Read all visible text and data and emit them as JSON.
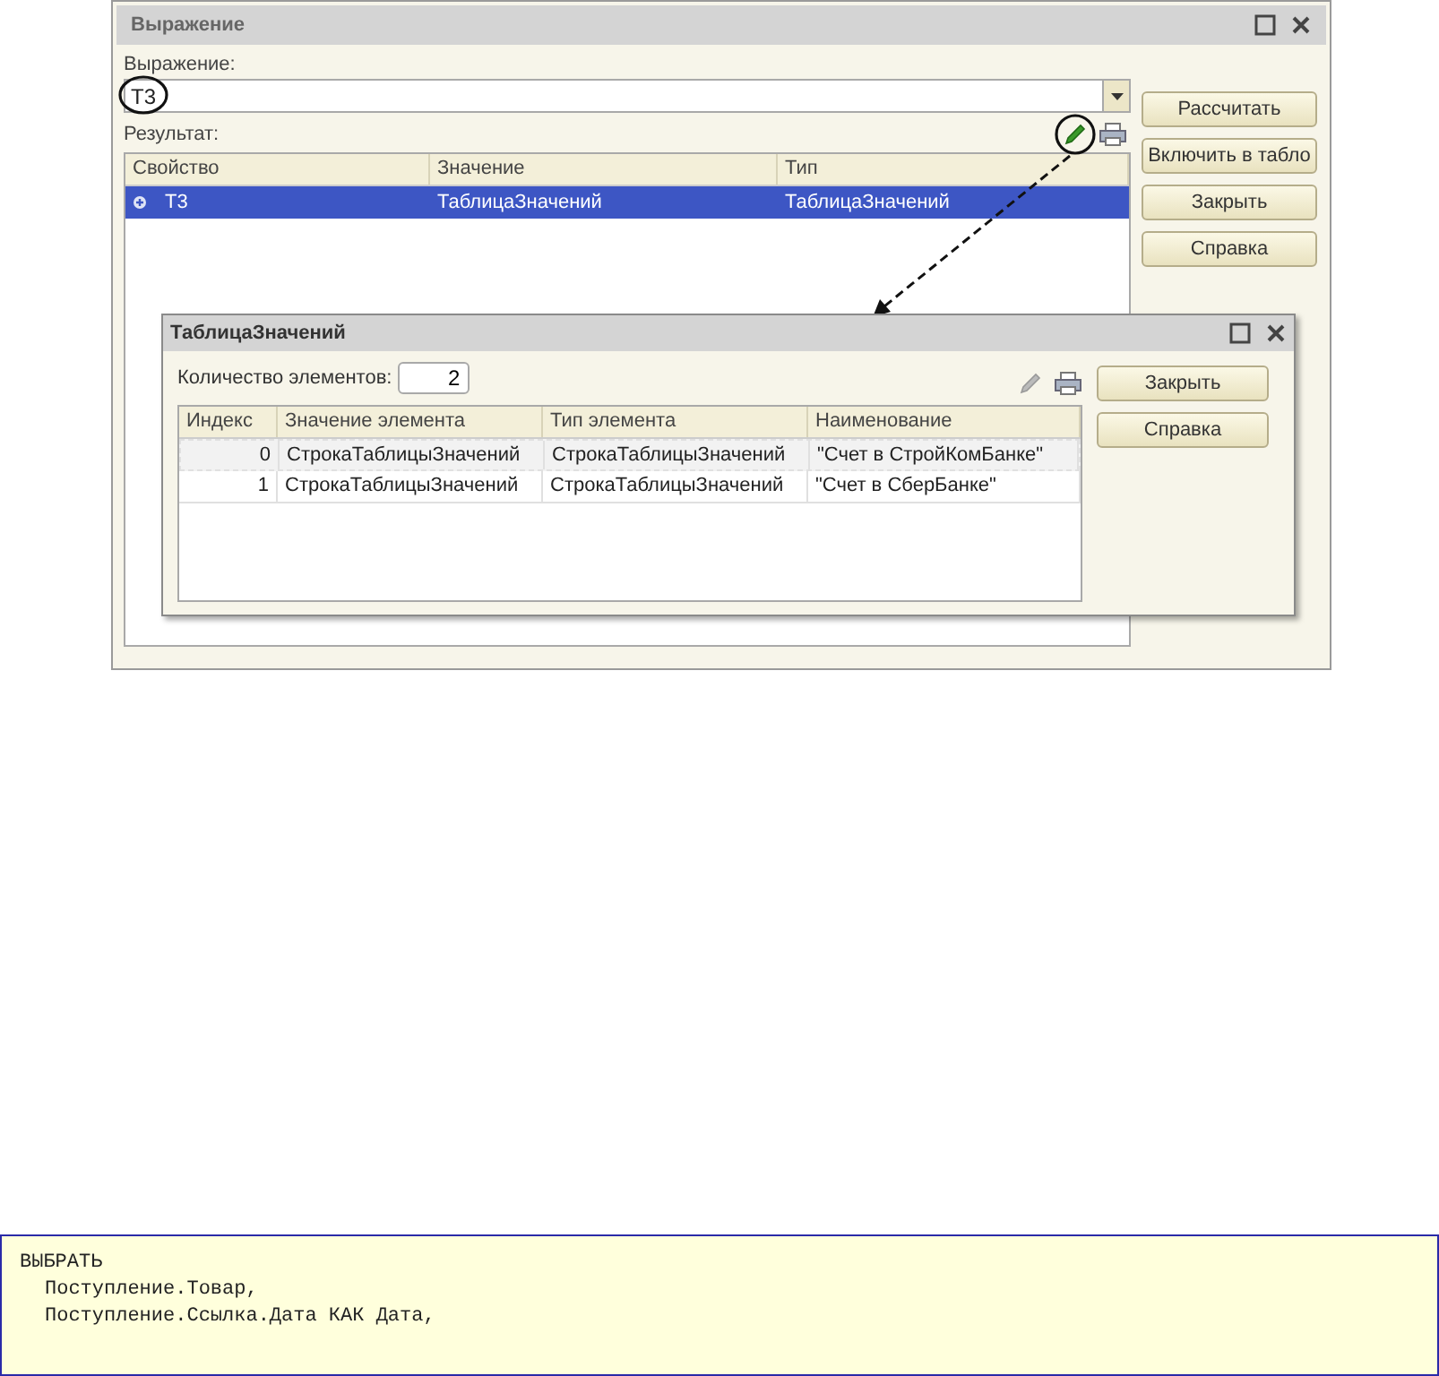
{
  "window": {
    "title": "Выражение"
  },
  "expression": {
    "label": "Выражение:",
    "value": "Т3"
  },
  "result": {
    "label": "Результат:",
    "columns": [
      "Свойство",
      "Значение",
      "Тип"
    ],
    "rows": [
      {
        "cells": [
          "Т3",
          "ТаблицаЗначений",
          "ТаблицаЗначений"
        ],
        "selected": true,
        "expandable": true
      }
    ]
  },
  "buttons": [
    "Рассчитать",
    "Включить в табло",
    "Закрыть",
    "Справка"
  ],
  "subwindow": {
    "title": "ТаблицаЗначений",
    "count_label": "Количество элементов:",
    "count_value": "2",
    "columns": [
      "Индекс",
      "Значение элемента",
      "Тип элемента",
      "Наименование"
    ],
    "rows": [
      {
        "cells": [
          "0",
          "СтрокаТаблицыЗначений",
          "СтрокаТаблицыЗначений",
          "\"Счет в СтройКомБанке\""
        ],
        "selected": true
      },
      {
        "cells": [
          "1",
          "СтрокаТаблицыЗначений",
          "СтрокаТаблицыЗначений",
          "\"Счет в СберБанке\""
        ],
        "selected": false
      }
    ],
    "buttons": [
      "Закрыть",
      "Справка"
    ]
  },
  "code": {
    "lines": [
      {
        "text": "ВЫБРАТЬ",
        "children": [
          {
            "text": "Поступление.Товар,"
          },
          {
            "text": "Поступление.Ссылка.Дата КАК Дата,"
          }
        ]
      }
    ]
  }
}
